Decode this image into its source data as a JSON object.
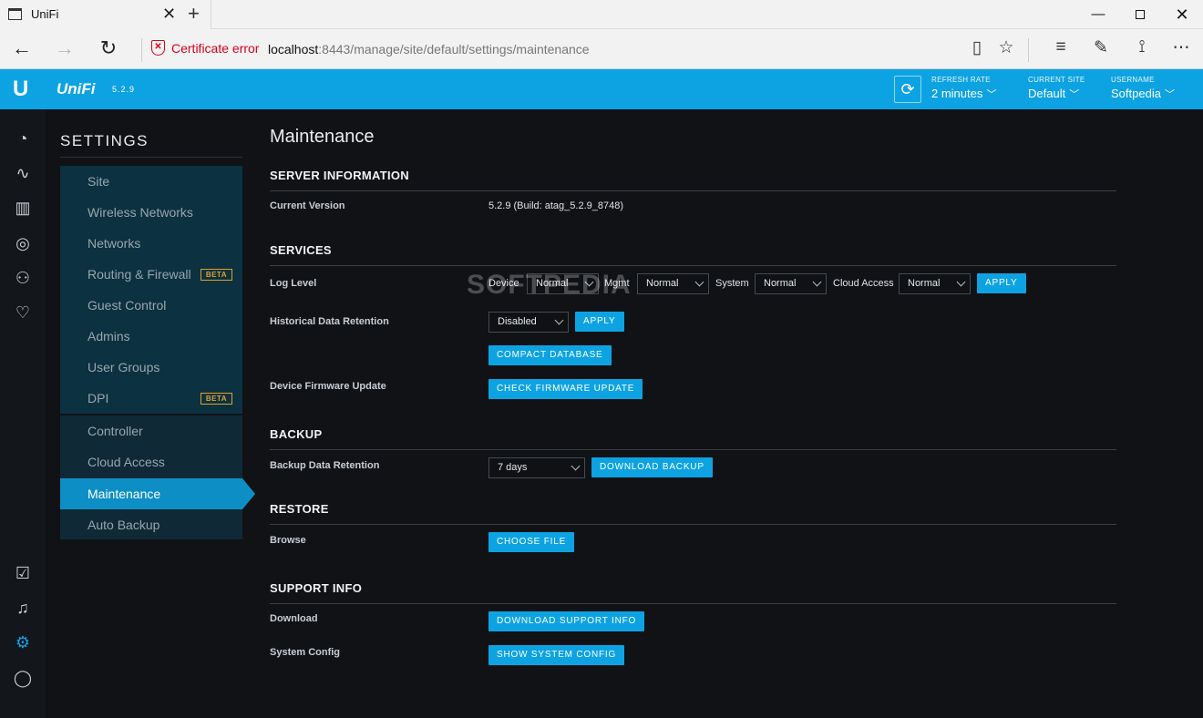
{
  "browser": {
    "tab_title": "UniFi",
    "cert_error": "Certificate error",
    "url_host": "localhost",
    "url_path": ":8443/manage/site/default/settings/maintenance"
  },
  "header": {
    "app_name": "UniFi",
    "version": "5.2.9",
    "refresh_rate_label": "REFRESH RATE",
    "refresh_rate_value": "2 minutes",
    "current_site_label": "CURRENT SITE",
    "current_site_value": "Default",
    "username_label": "USERNAME",
    "username_value": "Softpedia"
  },
  "settings": {
    "title": "SETTINGS",
    "site_items": [
      {
        "label": "Site"
      },
      {
        "label": "Wireless Networks"
      },
      {
        "label": "Networks"
      },
      {
        "label": "Routing & Firewall",
        "badge": "BETA"
      },
      {
        "label": "Guest Control"
      },
      {
        "label": "Admins"
      },
      {
        "label": "User Groups"
      },
      {
        "label": "DPI",
        "badge": "BETA"
      }
    ],
    "controller_items": [
      {
        "label": "Controller"
      },
      {
        "label": "Cloud Access"
      },
      {
        "label": "Maintenance"
      },
      {
        "label": "Auto Backup"
      }
    ],
    "active": "Maintenance"
  },
  "main": {
    "title": "Maintenance",
    "server_info": {
      "heading": "SERVER INFORMATION",
      "current_version_label": "Current Version",
      "current_version_value": "5.2.9 (Build: atag_5.2.9_8748)"
    },
    "services": {
      "heading": "SERVICES",
      "log_level_label": "Log Level",
      "device_label": "Device",
      "device_value": "Normal",
      "mgmt_label": "Mgmt",
      "mgmt_value": "Normal",
      "system_label": "System",
      "system_value": "Normal",
      "cloud_label": "Cloud Access",
      "cloud_value": "Normal",
      "apply_label": "APPLY",
      "retention_label": "Historical Data Retention",
      "retention_value": "Disabled",
      "retention_apply": "APPLY",
      "compact_db": "COMPACT DATABASE",
      "firmware_label": "Device Firmware Update",
      "check_firmware": "CHECK FIRMWARE UPDATE"
    },
    "backup": {
      "heading": "BACKUP",
      "retention_label": "Backup Data Retention",
      "retention_value": "7 days",
      "download_backup": "DOWNLOAD BACKUP"
    },
    "restore": {
      "heading": "RESTORE",
      "browse_label": "Browse",
      "choose_file": "CHOOSE FILE"
    },
    "support": {
      "heading": "SUPPORT INFO",
      "download_label": "Download",
      "download_support": "DOWNLOAD SUPPORT INFO",
      "system_config_label": "System Config",
      "show_system_config": "SHOW SYSTEM CONFIG"
    }
  },
  "watermark": "SOFTPEDIA",
  "colors": {
    "accent": "#0da3e2",
    "beta": "#e0a02a",
    "cert_error": "#d9001b"
  }
}
